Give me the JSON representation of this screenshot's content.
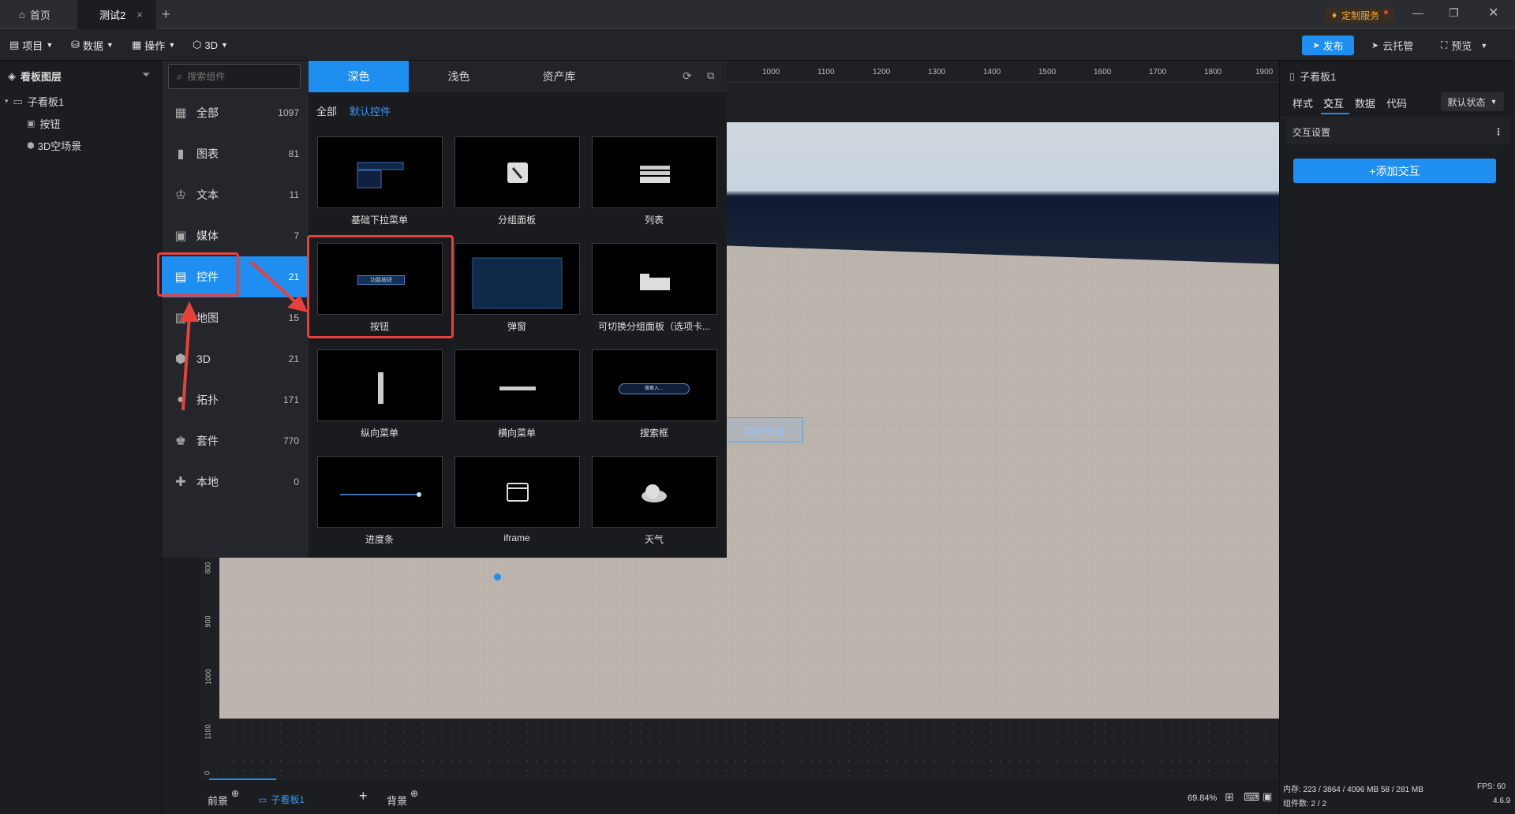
{
  "titlebar": {
    "tabs": [
      {
        "label": "首页"
      },
      {
        "label": "测试2"
      }
    ],
    "custom_service": "定制服务"
  },
  "toolbar": {
    "menus": [
      "项目",
      "数据",
      "操作",
      "3D"
    ],
    "publish": "发布",
    "cloud": "云托管",
    "preview": "预览"
  },
  "layers": {
    "title": "看板图层",
    "root": "子看板1",
    "children": [
      "按钮",
      "3D空场景"
    ]
  },
  "search": {
    "placeholder": "搜索组件"
  },
  "categories": [
    {
      "label": "全部",
      "count": "1097",
      "icon": "grid-icon"
    },
    {
      "label": "图表",
      "count": "81",
      "icon": "chart-icon"
    },
    {
      "label": "文本",
      "count": "11",
      "icon": "text-icon"
    },
    {
      "label": "媒体",
      "count": "7",
      "icon": "media-icon"
    },
    {
      "label": "控件",
      "count": "21",
      "icon": "control-icon"
    },
    {
      "label": "地图",
      "count": "15",
      "icon": "map-icon"
    },
    {
      "label": "3D",
      "count": "21",
      "icon": "cube-icon"
    },
    {
      "label": "拓扑",
      "count": "171",
      "icon": "topology-icon"
    },
    {
      "label": "套件",
      "count": "770",
      "icon": "kit-icon"
    },
    {
      "label": "本地",
      "count": "0",
      "icon": "puzzle-icon"
    }
  ],
  "gallery": {
    "tabs": [
      "深色",
      "浅色",
      "资产库"
    ],
    "filters": [
      "全部",
      "默认控件"
    ],
    "items": [
      "基础下拉菜单",
      "分组面板",
      "列表",
      "按钮",
      "弹窗",
      "可切换分组面板（选项卡...",
      "纵向菜单",
      "横向菜单",
      "搜索框",
      "进度条",
      "iframe",
      "天气"
    ],
    "thumb_button_text": "功能按钮",
    "thumb_search_text": "搜索入..."
  },
  "ruler": {
    "top": [
      "1000",
      "1100",
      "1200",
      "1300",
      "1400",
      "1500",
      "1600",
      "1700",
      "1800",
      "1900"
    ],
    "left": [
      "800",
      "900",
      "1000",
      "1100",
      "0"
    ]
  },
  "canvas": {
    "button_text": "功能按钮"
  },
  "right": {
    "title": "子看板1",
    "tabs": [
      "样式",
      "交互",
      "数据",
      "代码"
    ],
    "state": "默认状态",
    "section": "交互设置",
    "add": "+添加交互"
  },
  "bottom": {
    "front": "前景",
    "board": "子看板1",
    "back": "背景",
    "zoom": "69.84%"
  },
  "status": {
    "memory": "内存: 223 / 3864 / 4096 MB 58 / 281 MB",
    "fps": "FPS: 60",
    "components": "组件数: 2 / 2",
    "version": "4.6.9"
  },
  "colors": {
    "accent": "#1e8ef0",
    "highlight": "#e8413c"
  }
}
